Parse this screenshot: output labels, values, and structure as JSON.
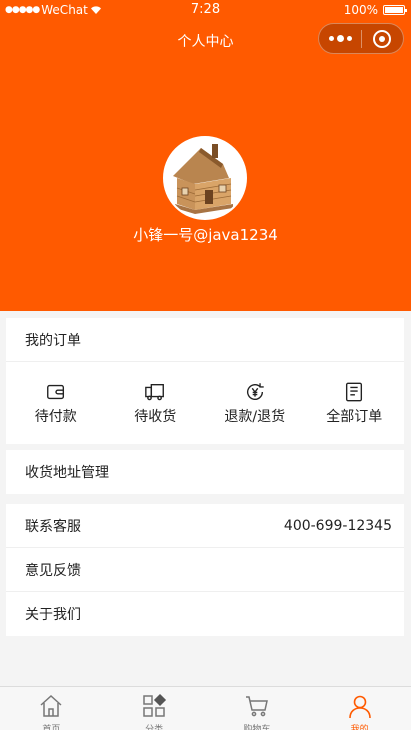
{
  "status_bar": {
    "signal": "●●●●●",
    "carrier": "WeChat",
    "wifi": "wifi-icon",
    "time": "7:28",
    "battery": "100%"
  },
  "nav": {
    "title": "个人中心"
  },
  "profile": {
    "username": "小锋一号@java1234"
  },
  "orders": {
    "title": "我的订单",
    "items": [
      {
        "label": "待付款",
        "icon": "wallet-icon"
      },
      {
        "label": "待收货",
        "icon": "truck-icon"
      },
      {
        "label": "退款/退货",
        "icon": "yen-refund-icon"
      },
      {
        "label": "全部订单",
        "icon": "document-list-icon"
      }
    ]
  },
  "address": {
    "label": "收货地址管理"
  },
  "service": {
    "contact_label": "联系客服",
    "contact_phone": "400-699-12345",
    "feedback_label": "意见反馈",
    "about_label": "关于我们"
  },
  "tabbar": {
    "items": [
      {
        "label": "首页",
        "icon": "home-icon"
      },
      {
        "label": "分类",
        "icon": "category-icon"
      },
      {
        "label": "购物车",
        "icon": "cart-icon"
      },
      {
        "label": "我的",
        "icon": "user-icon"
      }
    ],
    "active_index": 3,
    "active_color": "#ff5a00"
  },
  "colors": {
    "brand": "#ff5a00",
    "background": "#f4f4f4"
  }
}
